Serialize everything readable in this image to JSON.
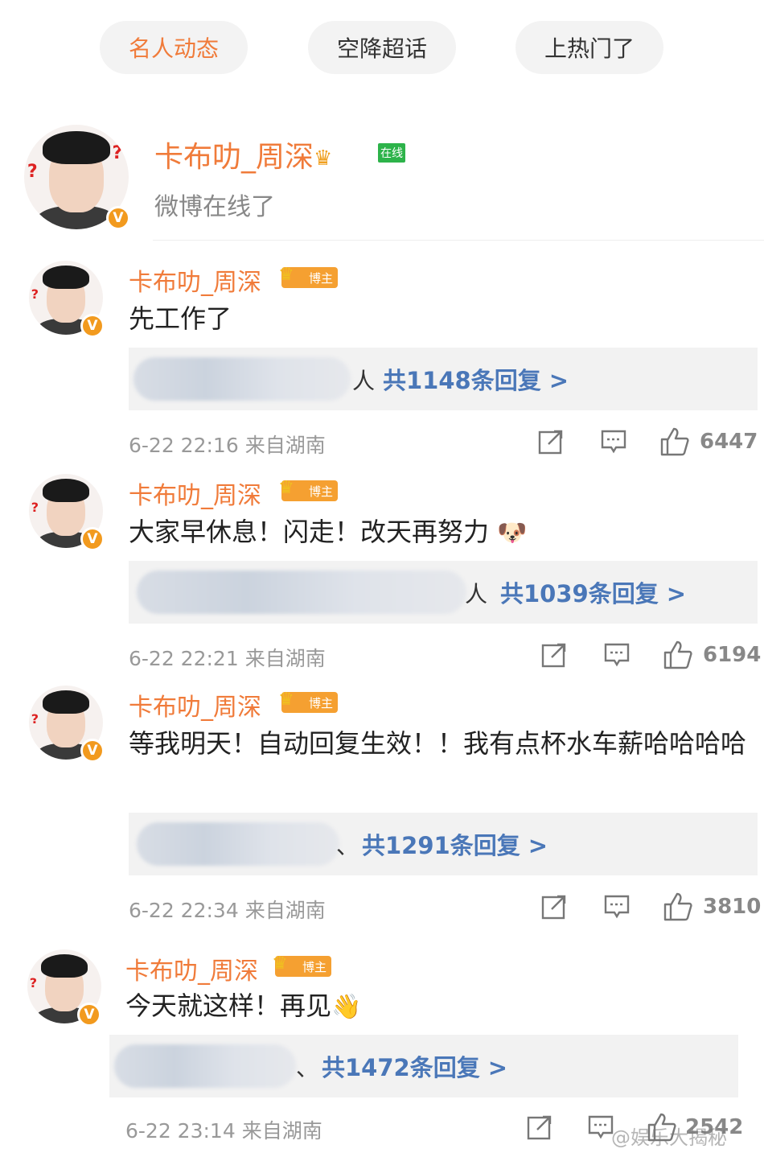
{
  "tabs": [
    {
      "label": "名人动态",
      "active": true
    },
    {
      "label": "空降超话",
      "active": false
    },
    {
      "label": "上热门了",
      "active": false
    }
  ],
  "header": {
    "name": "卡布叻_周深",
    "online_tag": "在线",
    "status": "微博在线了"
  },
  "comments": [
    {
      "name": "卡布叻_周深",
      "tag": "博主",
      "text": "先工作了",
      "reply_suffix": "人",
      "reply_link": "共1148条回复 >",
      "time": "6-22 22:16",
      "location": "来自湖南",
      "likes": "6447"
    },
    {
      "name": "卡布叻_周深",
      "tag": "博主",
      "text": "大家早休息！闪走！改天再努力",
      "reply_suffix": "人",
      "reply_link": "共1039条回复 >",
      "time": "6-22 22:21",
      "location": "来自湖南",
      "likes": "6194"
    },
    {
      "name": "卡布叻_周深",
      "tag": "博主",
      "text": "等我明天！自动回复生效！！我有点杯水车薪哈哈哈哈",
      "reply_suffix": "、",
      "reply_link": "共1291条回复 >",
      "time": "6-22 22:34",
      "location": "来自湖南",
      "likes": "3810"
    },
    {
      "name": "卡布叻_周深",
      "tag": "博主",
      "text": "今天就这样！再见",
      "reply_suffix": "、",
      "reply_link": "共1472条回复 >",
      "time": "6-22 23:14",
      "location": "来自湖南",
      "likes": "2542"
    }
  ],
  "watermark": "@娱乐大揭秘",
  "colors": {
    "accent": "#f07b3a",
    "link": "#4a77b8",
    "badge": "#f29a1e"
  }
}
